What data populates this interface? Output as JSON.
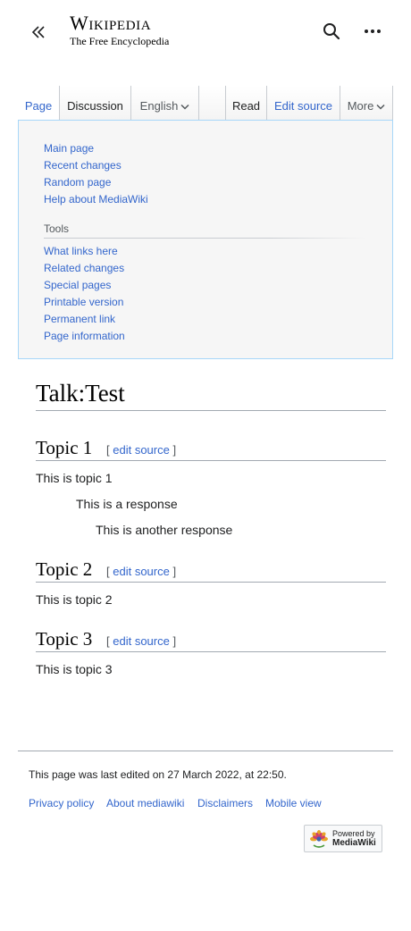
{
  "header": {
    "logo_wordmark": "Wikipedia",
    "logo_tagline": "The Free Encyclopedia",
    "collapse_icon": "double-chevron-left-icon",
    "search_icon": "search-icon",
    "more_icon": "ellipsis-icon"
  },
  "tabs": {
    "page": "Page",
    "discussion": "Discussion",
    "language": "English",
    "read": "Read",
    "edit_source": "Edit source",
    "more": "More"
  },
  "menu": {
    "navigation": [
      "Main page",
      "Recent changes",
      "Random page",
      "Help about MediaWiki"
    ],
    "tools_heading": "Tools",
    "tools": [
      "What links here",
      "Related changes",
      "Special pages",
      "Printable version",
      "Permanent link",
      "Page information"
    ]
  },
  "content": {
    "title": "Talk:Test",
    "edit_open": "[",
    "edit_link": "edit source",
    "edit_close": "]",
    "sections": [
      {
        "heading": "Topic 1",
        "paragraphs": [
          "This is topic 1",
          "This is a response",
          "This is another response"
        ]
      },
      {
        "heading": "Topic 2",
        "paragraphs": [
          "This is topic 2"
        ]
      },
      {
        "heading": "Topic 3",
        "paragraphs": [
          "This is topic 3"
        ]
      }
    ]
  },
  "footer": {
    "last_modified": "This page was last edited on 27 March 2022, at 22:50.",
    "links": [
      "Privacy policy",
      "About mediawiki",
      "Disclaimers",
      "Mobile view"
    ],
    "powered_line1": "Powered by",
    "powered_line2": "MediaWiki"
  },
  "colors": {
    "link": "#3366cc",
    "text": "#202122",
    "menu_border": "#a7d7f9",
    "menu_bg": "#f6f6f6",
    "rule": "#a2a9b1"
  }
}
